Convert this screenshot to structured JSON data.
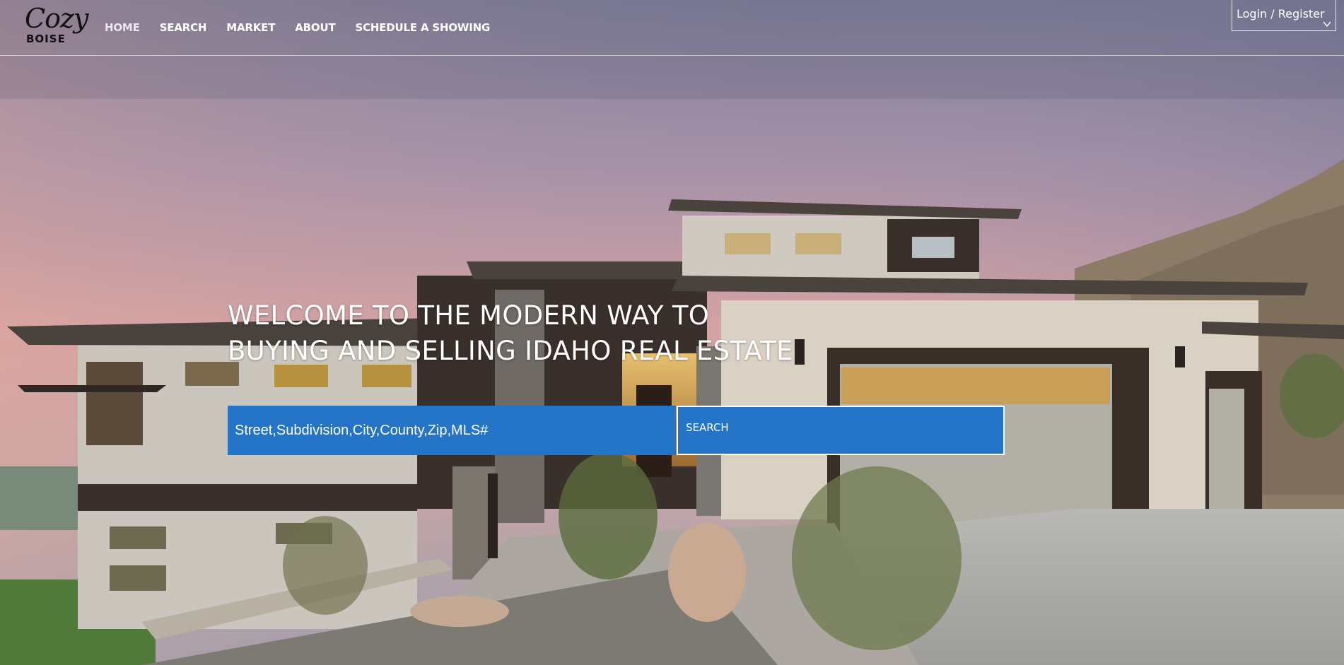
{
  "brand": {
    "logo_top": "Cozy",
    "logo_bottom": "BOISE"
  },
  "nav": {
    "items": [
      {
        "label": "HOME"
      },
      {
        "label": "SEARCH"
      },
      {
        "label": "MARKET"
      },
      {
        "label": "ABOUT"
      },
      {
        "label": "SCHEDULE A SHOWING"
      }
    ],
    "active": "HOME"
  },
  "account": {
    "login_label": "Login / Register"
  },
  "hero": {
    "headline_line1": "WELCOME TO THE MODERN WAY TO",
    "headline_line2": "BUYING AND SELLING IDAHO REAL ESTATE"
  },
  "search": {
    "placeholder": "Street,Subdivision,City,County,Zip,MLS#",
    "value": "",
    "button_label": "SEARCH"
  },
  "colors": {
    "accent": "#2474c8",
    "text": "#ffffff"
  }
}
